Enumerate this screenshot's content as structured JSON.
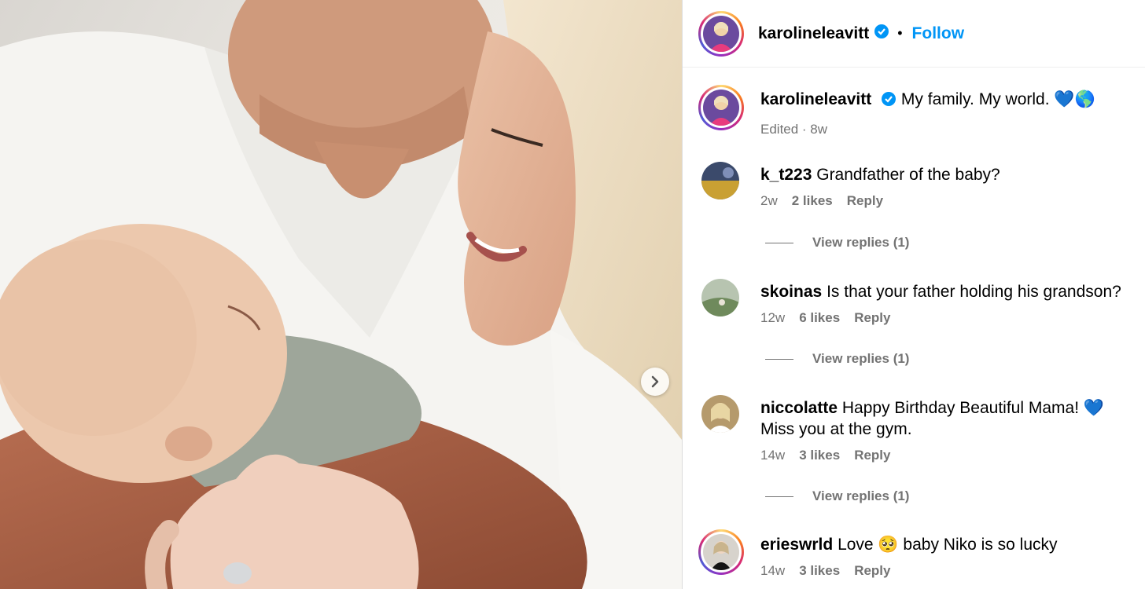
{
  "post": {
    "author": "karolineleavitt",
    "follow_label": "Follow",
    "separator": "•",
    "caption": "My family. My world. 💙🌎",
    "caption_meta": "Edited · 8w",
    "verified_icon": "verified-badge-icon",
    "next_icon": "chevron-right-icon"
  },
  "comments": [
    {
      "username": "k_t223",
      "text": "Grandfather of the baby?",
      "age": "2w",
      "likes": "2 likes",
      "reply": "Reply",
      "view_replies": "View replies (1)"
    },
    {
      "username": "skoinas",
      "text": "Is that your father holding his grandson?",
      "age": "12w",
      "likes": "6 likes",
      "reply": "Reply",
      "view_replies": "View replies (1)"
    },
    {
      "username": "niccolatte",
      "text": "Happy Birthday Beautiful Mama! 💙",
      "text2": "Miss you at the gym.",
      "age": "14w",
      "likes": "3 likes",
      "reply": "Reply",
      "view_replies": "View replies (1)"
    },
    {
      "username": "erieswrld",
      "text": "Love 🥺 baby Niko is so lucky",
      "age": "14w",
      "likes": "3 likes",
      "reply": "Reply"
    }
  ],
  "colors": {
    "link_blue": "#0095f6",
    "verified_blue": "#0095f6",
    "meta_gray": "#737373"
  }
}
